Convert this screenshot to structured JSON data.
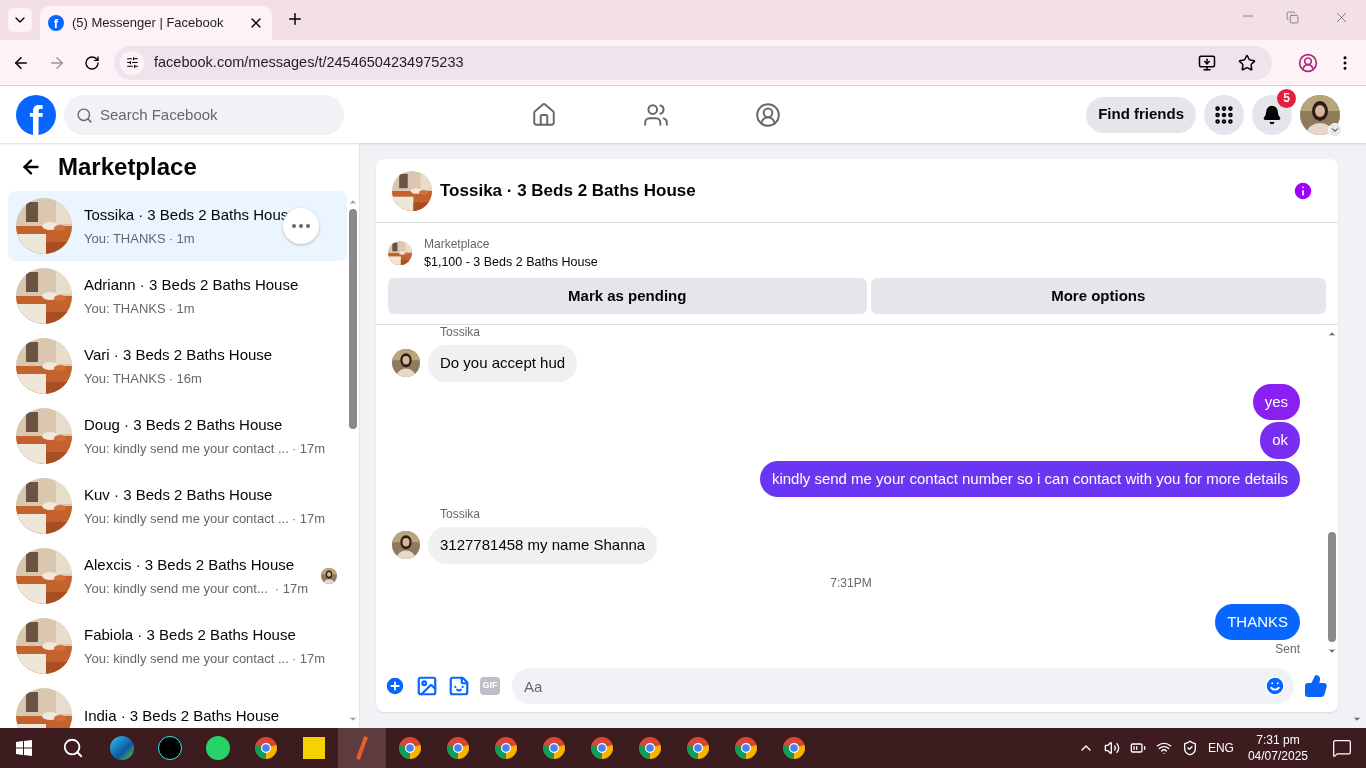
{
  "browser": {
    "tab": {
      "favicon_letter": "f",
      "title": "(5) Messenger | Facebook"
    },
    "url": "facebook.com/messages/t/24546504234975233"
  },
  "header": {
    "logo_letter": "f",
    "search_placeholder": "Search Facebook",
    "nav": [
      {
        "kind": "home",
        "selected": false
      },
      {
        "kind": "friends",
        "selected": false
      },
      {
        "kind": "groups",
        "selected": false
      }
    ],
    "find_friends": "Find friends",
    "notification_count": "5"
  },
  "sidebar": {
    "title": "Marketplace",
    "conversations": [
      {
        "name": "Tossika · 3 Beds 2 Baths Hous",
        "preview": "You: THANKS",
        "time": "· 1m",
        "selected": true,
        "seen_avatar": false
      },
      {
        "name": "Adriann · 3 Beds 2 Baths House",
        "preview": "You: THANKS",
        "time": "· 1m",
        "selected": false,
        "seen_avatar": false
      },
      {
        "name": "Vari · 3 Beds 2 Baths House",
        "preview": "You: THANKS",
        "time": "· 16m",
        "selected": false,
        "seen_avatar": false
      },
      {
        "name": "Doug · 3 Beds 2 Baths House",
        "preview": "You: kindly send me your contact ...",
        "time": "· 17m",
        "selected": false,
        "seen_avatar": false
      },
      {
        "name": "Kuv · 3 Beds 2 Baths House",
        "preview": "You: kindly send me your contact ...",
        "time": "· 17m",
        "selected": false,
        "seen_avatar": false
      },
      {
        "name": "Alexcis · 3 Beds 2 Baths House",
        "preview": "You: kindly send me your cont...",
        "time": "· 17m",
        "selected": false,
        "seen_avatar": true
      },
      {
        "name": "Fabiola · 3 Beds 2 Baths House",
        "preview": "You: kindly send me your contact ...",
        "time": "· 17m",
        "selected": false,
        "seen_avatar": false
      },
      {
        "name": "India · 3 Beds 2 Baths House",
        "selected": false,
        "seen_avatar": false
      }
    ]
  },
  "chat": {
    "title": "Tossika · 3 Beds 2 Baths House",
    "listing": {
      "label": "Marketplace",
      "item": "$1,100 - 3 Beds 2 Baths House"
    },
    "buttons": [
      "Mark as pending",
      "More options"
    ],
    "messages": [
      {
        "kind": "sender",
        "text": "Tossika"
      },
      {
        "kind": "incoming",
        "text": "Do you accept hud"
      },
      {
        "kind": "gap"
      },
      {
        "kind": "outgoing",
        "text": "yes",
        "color": "#8a1ff2"
      },
      {
        "kind": "outgoing",
        "text": "ok",
        "color": "#7a2cf2"
      },
      {
        "kind": "outgoing",
        "text": "kindly send me your contact number so i can contact with you for more details",
        "color": "#6b36f2"
      },
      {
        "kind": "sender",
        "text": "Tossika"
      },
      {
        "kind": "incoming",
        "text": "3127781458 my name Shanna"
      },
      {
        "kind": "timestamp",
        "text": "7:31PM"
      },
      {
        "kind": "outgoing",
        "text": "THANKS",
        "color": "#0866ff"
      },
      {
        "kind": "status",
        "text": "Sent"
      }
    ],
    "composer": {
      "gif_label": "GIF",
      "placeholder": "Aa"
    }
  },
  "taskbar": {
    "language": "ENG",
    "time": "7:31 pm",
    "date": "04/07/2025"
  }
}
